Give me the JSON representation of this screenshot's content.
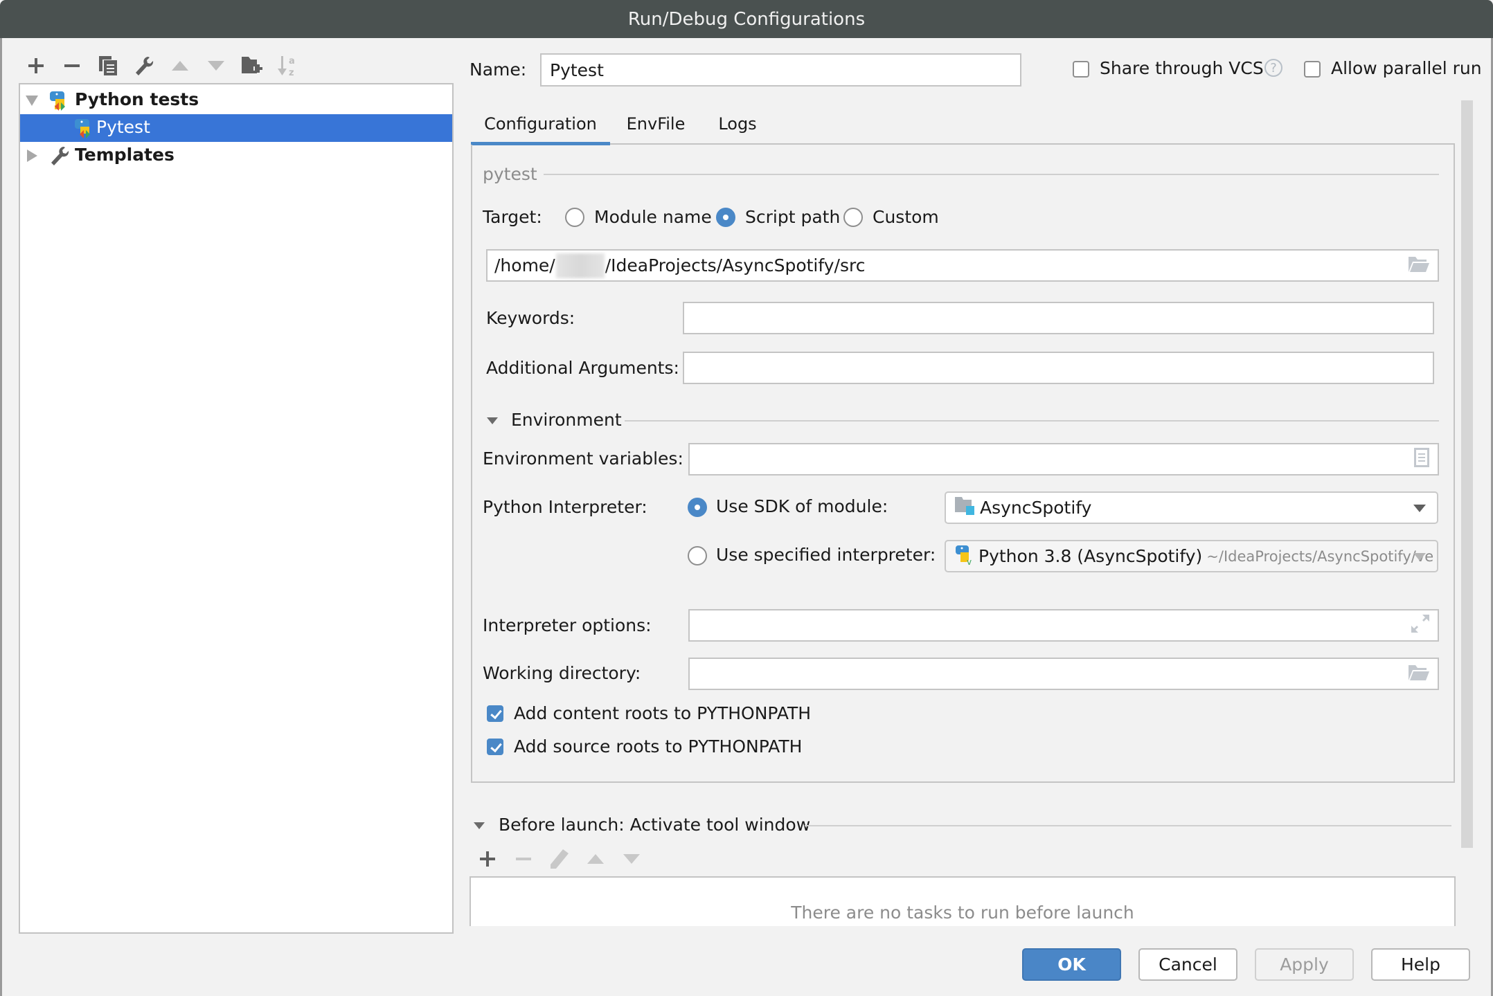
{
  "window": {
    "title": "Run/Debug Configurations"
  },
  "left_toolbar": {
    "icons": [
      "add-icon",
      "remove-icon",
      "copy-icon",
      "edit-defaults-wrench-icon",
      "move-up-icon",
      "move-down-icon",
      "new-folder-icon",
      "sort-alphabetically-icon"
    ]
  },
  "tree": {
    "items": [
      {
        "label": "Python tests",
        "expanded": true,
        "icon": "python-tests-icon",
        "level": 0
      },
      {
        "label": "Pytest",
        "selected": true,
        "icon": "python-tests-icon",
        "level": 1
      },
      {
        "label": "Templates",
        "expanded": false,
        "icon": "wrench-icon",
        "level": 0
      }
    ]
  },
  "header": {
    "name_label": "Name:",
    "name_value": "Pytest",
    "share_vcs": {
      "label": "Share through VCS",
      "checked": false,
      "help": "?"
    },
    "allow_parallel": {
      "label": "Allow parallel run",
      "checked": false
    }
  },
  "tabs": [
    {
      "label": "Configuration",
      "active": true
    },
    {
      "label": "EnvFile",
      "active": false
    },
    {
      "label": "Logs",
      "active": false
    }
  ],
  "config": {
    "section_title": "pytest",
    "target": {
      "label": "Target:",
      "options": [
        "Module name",
        "Script path",
        "Custom"
      ],
      "selected": "Script path"
    },
    "path": {
      "prefix": "/home/",
      "suffix": "/IdeaProjects/AsyncSpotify/src"
    },
    "keywords": {
      "label": "Keywords:",
      "value": ""
    },
    "additional_arguments": {
      "label": "Additional Arguments:",
      "value": ""
    },
    "environment": {
      "title": "Environment",
      "env_vars": {
        "label": "Environment variables:",
        "value": ""
      },
      "interpreter": {
        "label": "Python Interpreter:",
        "use_sdk_label": "Use SDK of module:",
        "use_sdk_selected": true,
        "sdk_module": "AsyncSpotify",
        "use_specified_label": "Use specified interpreter:",
        "specified_name": "Python 3.8 (AsyncSpotify)",
        "specified_path": "~/IdeaProjects/AsyncSpotify/ve"
      },
      "interpreter_options": {
        "label": "Interpreter options:",
        "value": ""
      },
      "working_directory": {
        "label": "Working directory:",
        "value": ""
      },
      "add_content_roots": {
        "label": "Add content roots to PYTHONPATH",
        "checked": true
      },
      "add_source_roots": {
        "label": "Add source roots to PYTHONPATH",
        "checked": true
      }
    }
  },
  "before_launch": {
    "title": "Before launch: Activate tool window",
    "empty_text": "There are no tasks to run before launch"
  },
  "buttons": {
    "ok": "OK",
    "cancel": "Cancel",
    "apply": "Apply",
    "help": "Help"
  },
  "colors": {
    "accent": "#4a88c7",
    "selection": "#3875d7",
    "titlebar": "#4a5150"
  }
}
